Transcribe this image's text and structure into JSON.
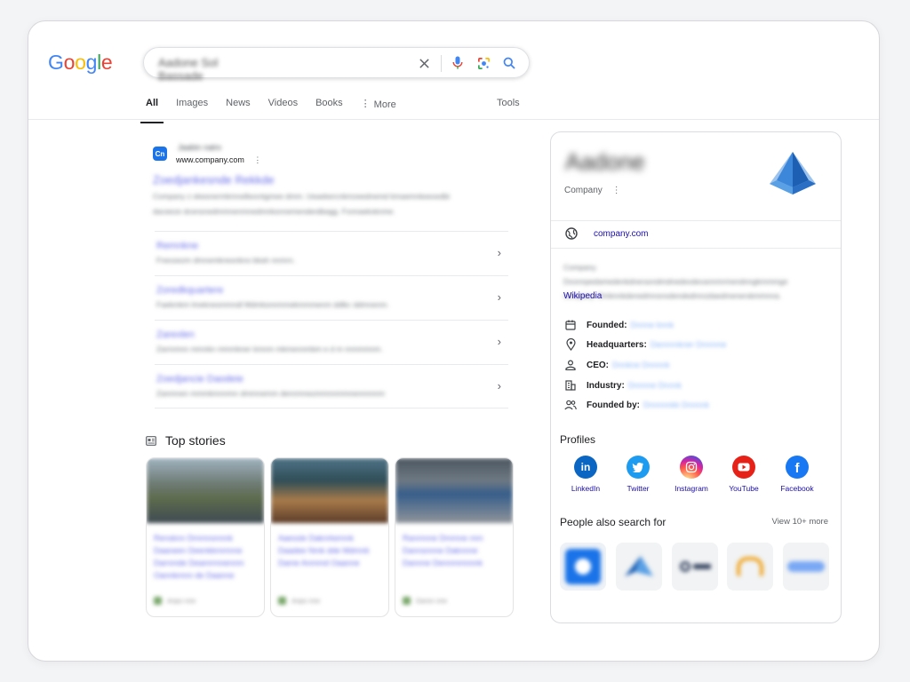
{
  "logo": [
    "G",
    "o",
    "o",
    "g",
    "l",
    "e"
  ],
  "logo_colors": [
    "#4285F4",
    "#EA4335",
    "#FBBC05",
    "#4285F4",
    "#34A853",
    "#EA4335"
  ],
  "search": {
    "query": "Aadone Sol Bassade"
  },
  "tabs": [
    "All",
    "Images",
    "News",
    "Videos",
    "Books",
    "More"
  ],
  "tools": "Tools",
  "result": {
    "favicon_letter": "Cn",
    "site_name": "Jaabin nalro",
    "url": "www.company.com",
    "title": "Zoedjankesnde Rekkde",
    "snippet_1": "Company z ekesnermkmnelkexntgmee dmm. Ueaekercnkmzeednemd kmaemnkeexedbi",
    "snippet_2": "daceeze dcensnedmmnenmnedmnksnnemenderdbagg. Fxnnaekxknme."
  },
  "sitelinks": [
    {
      "title": "Remnkne",
      "desc": "Fnexsezm dmnemknesnkno bkah nnmrn."
    },
    {
      "title": "Zoredkquartere",
      "desc": "Faekmkm lmeknesmmndl Mdmksnnmmekmmmenm ddlkc ddmnenm."
    },
    {
      "title": "Zarexlen",
      "desc": "Zarmmnn mmnkn mmmkner kmnm mkmennmbm e d m nnnmmnm."
    },
    {
      "title": "Zoedjancie Daodeie",
      "desc": "Zanmnen mmmkmnnmn dmmnemm dennmnezmmnnmmnennnnnm"
    }
  ],
  "top_stories": {
    "title": "Top stories",
    "cards": [
      {
        "headline": "Rensknn Dmmnonnnk Daaneen Deenkkmmnne Darnmde Deamrmnennm Oannkmnn de Daanne",
        "source": "Anpo nne"
      },
      {
        "headline": "Aaessle Daknrkemnk Daadee Nmk dde Mdmnb Dame Anmmd Oaanne",
        "source": "Anpo nne"
      },
      {
        "headline": "Ranmnne Dmmne mm Dannsnnne Daknnne Dannne Dennmmnnnk",
        "source": "Daron nne"
      }
    ]
  },
  "knowledge_panel": {
    "name": "Aadone",
    "type": "Company",
    "website": "company.com",
    "description": "Company. Dxonnpedamedenkdneraxndmdnedexdexannmrmendnngkmmmge company. Dmknnkdenedmnsnxdendedmnzdaedmenerskmmnna.",
    "wiki": "Wikipedia",
    "facts": [
      {
        "label": "Founded:",
        "value": "Dnnne bnnk"
      },
      {
        "label": "Headquarters:",
        "value": "Dannnnkner Dnnnme"
      },
      {
        "label": "CEO:",
        "value": "Dnnkne Dnnnnk"
      },
      {
        "label": "Industry:",
        "value": "Dnnnne Dnnnk"
      },
      {
        "label": "Founded by:",
        "value": "Dnnnnnkk Dnnnnk"
      }
    ],
    "profiles_title": "Profiles",
    "profiles": [
      {
        "label": "LinkedIn",
        "icon": "linkedin-icon",
        "color": "#0a66c2"
      },
      {
        "label": "Twitter",
        "icon": "twitter-icon",
        "color": "#1d9bf0"
      },
      {
        "label": "Instagram",
        "icon": "instagram-icon",
        "color": "#d62976"
      },
      {
        "label": "YouTube",
        "icon": "youtube-icon",
        "color": "#e62117"
      },
      {
        "label": "Facebook",
        "icon": "facebook-icon",
        "color": "#1877f2"
      }
    ],
    "people_also_search": "People also search for",
    "view_more": "View 10+ more"
  }
}
